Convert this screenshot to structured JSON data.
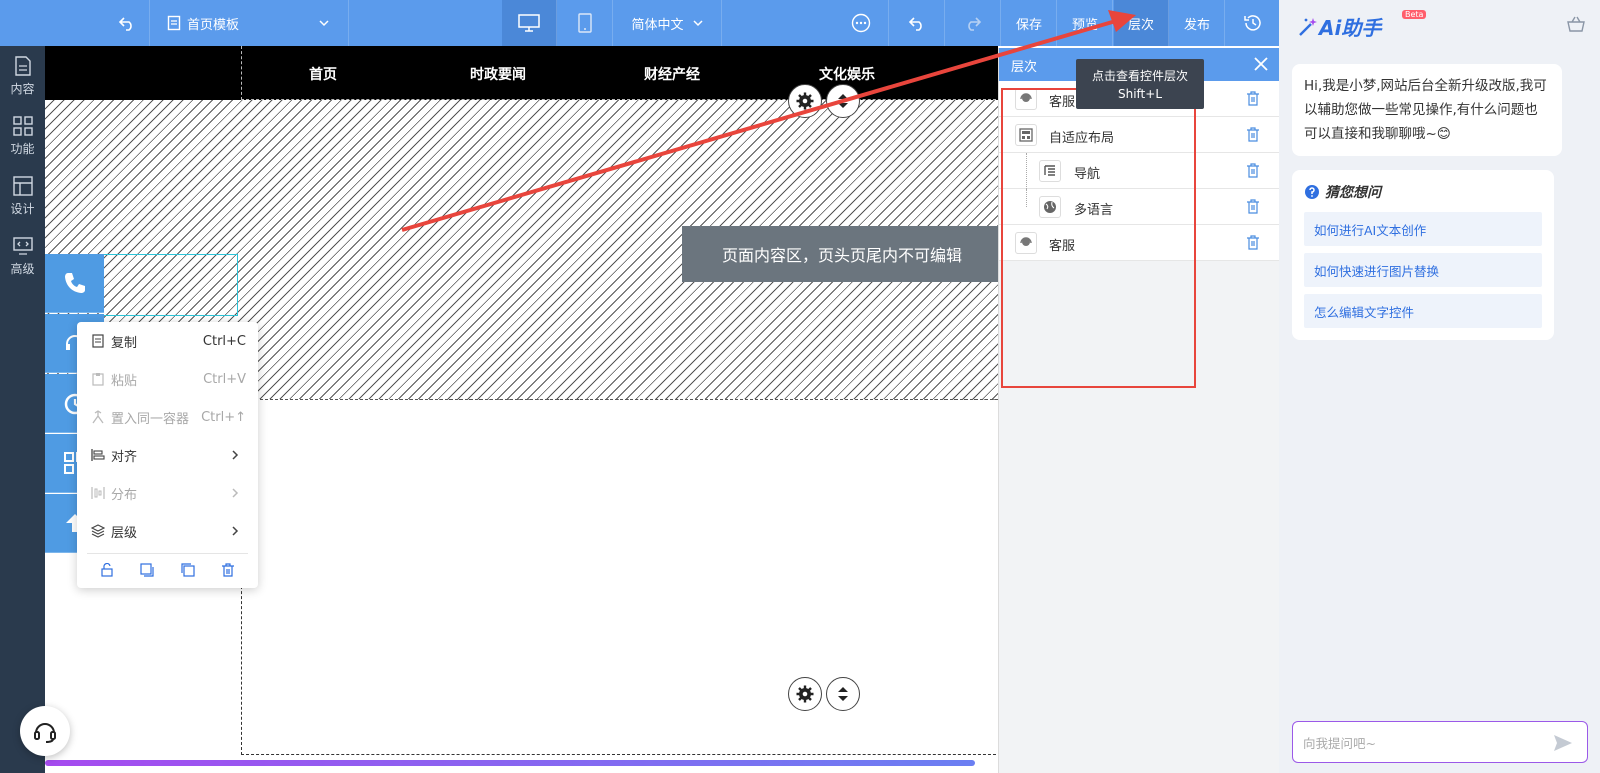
{
  "toolbar": {
    "template_name": "首页模板",
    "language": "简体中文",
    "save_label": "保存",
    "preview_label": "预览",
    "layers_label": "层次",
    "publish_label": "发布",
    "accent": "#5b9bec"
  },
  "leftnav": {
    "items": [
      {
        "label": "内容",
        "icon": "document-icon"
      },
      {
        "label": "功能",
        "icon": "grid-icon"
      },
      {
        "label": "设计",
        "icon": "layout-icon"
      },
      {
        "label": "高级",
        "icon": "code-monitor-icon"
      }
    ]
  },
  "canvas": {
    "nav_links": [
      "首页",
      "时政要闻",
      "财经产经",
      "文化娱乐"
    ],
    "notice": "页面内容区，页头页尾内不可编辑"
  },
  "context_menu": {
    "items": [
      {
        "label": "复制",
        "shortcut": "Ctrl+C",
        "disabled": false
      },
      {
        "label": "粘贴",
        "shortcut": "Ctrl+V",
        "disabled": true
      },
      {
        "label": "置入同一容器",
        "shortcut": "Ctrl+↑",
        "disabled": true
      },
      {
        "label": "对齐",
        "shortcut": "",
        "disabled": false
      },
      {
        "label": "分布",
        "shortcut": "",
        "disabled": true
      },
      {
        "label": "层级",
        "shortcut": "",
        "disabled": false
      }
    ]
  },
  "layer_panel": {
    "title": "层次",
    "tooltip_line1": "点击查看控件层次",
    "tooltip_line2": "Shift+L",
    "rows": [
      {
        "label": "客服",
        "icon": "service-icon"
      },
      {
        "label": "自适应布局",
        "icon": "layout-block-icon"
      },
      {
        "label": "导航",
        "icon": "list-tree-icon"
      },
      {
        "label": "多语言",
        "icon": "globe-icon"
      },
      {
        "label": "客服",
        "icon": "service-icon"
      }
    ],
    "highlight_color": "#e8453c"
  },
  "ai": {
    "brand": "Ai助手",
    "beta": "Beta",
    "greeting": "Hi,我是小梦,网站后台全新升级改版,我可以辅助您做一些常见操作,有什么问题也可以直接和我聊聊哦~😊",
    "guess_title": "猜您想问",
    "questions": [
      "如何进行AI文本创作",
      "如何快速进行图片替换",
      "怎么编辑文字控件"
    ],
    "input_placeholder": "向我提问吧~"
  }
}
